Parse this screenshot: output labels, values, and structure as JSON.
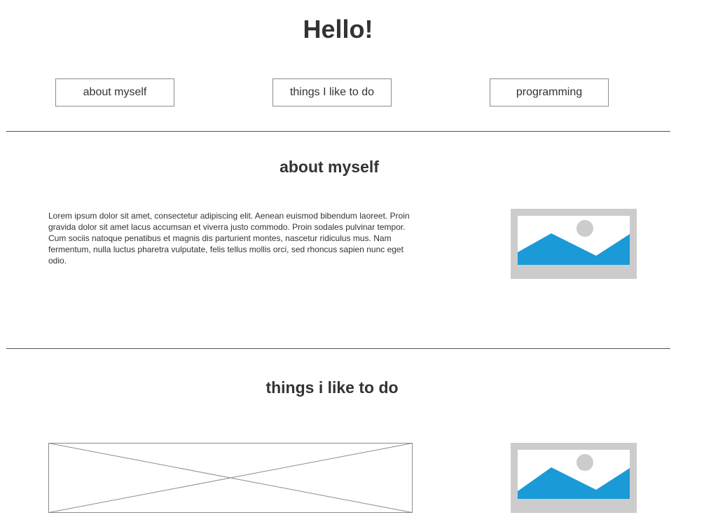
{
  "header": {
    "title": "Hello!"
  },
  "nav": {
    "buttons": [
      {
        "label": "about myself"
      },
      {
        "label": "things I like to do"
      },
      {
        "label": "programming"
      }
    ]
  },
  "sections": {
    "about": {
      "heading": "about myself",
      "text": "Lorem ipsum dolor sit amet, consectetur adipiscing elit. Aenean euismod bibendum laoreet. Proin gravida dolor sit amet lacus accumsan et viverra justo commodo. Proin sodales pulvinar tempor. Cum sociis natoque penatibus et magnis dis parturient montes, nascetur ridiculus mus. Nam fermentum, nulla luctus pharetra vulputate, felis tellus mollis orci, sed rhoncus sapien nunc eget odio.",
      "image_icon": "image-placeholder-icon"
    },
    "things": {
      "heading": "things i like to do",
      "media_icon": "empty-placeholder-icon",
      "image_icon": "image-placeholder-icon"
    }
  },
  "colors": {
    "text": "#333333",
    "frame": "#cccccc",
    "mountain": "#1a9ad6",
    "sun": "#cccccc",
    "border": "#8c8c8c"
  }
}
